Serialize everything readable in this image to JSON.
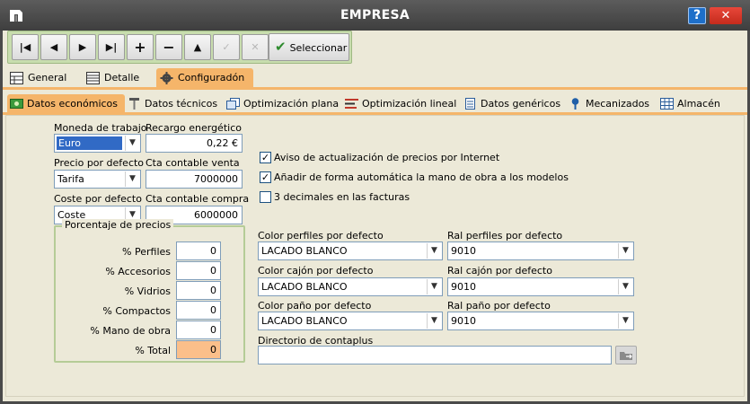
{
  "window": {
    "title": "EMPRESA",
    "help_label": "?",
    "close_label": "✕"
  },
  "toolbar": {
    "first_label": "|◀",
    "prev_label": "◀",
    "next_label": "▶",
    "last_label": "▶|",
    "add_label": "+",
    "remove_label": "−",
    "up_label": "▲",
    "confirm_label": "✓",
    "cancel_label": "✕",
    "select_label": "Seleccionar"
  },
  "main_tabs": [
    {
      "label": "General",
      "icon": "grid-icon"
    },
    {
      "label": "Detalle",
      "icon": "table-icon"
    },
    {
      "label": "Configuradón",
      "icon": "gear-icon",
      "active": true
    }
  ],
  "sub_tabs": [
    {
      "label": "Datos económicos",
      "icon": "money-icon",
      "active": true
    },
    {
      "label": "Datos técnicos",
      "icon": "tools-icon"
    },
    {
      "label": "Optimización plana",
      "icon": "pages-icon"
    },
    {
      "label": "Optimización lineal",
      "icon": "lines-icon"
    },
    {
      "label": "Datos genéricos",
      "icon": "document-icon"
    },
    {
      "label": "Mecanizados",
      "icon": "pin-icon"
    },
    {
      "label": "Almacén",
      "icon": "grid-icon"
    }
  ],
  "economic": {
    "currency_label": "Moneda de trabajo",
    "currency_value": "Euro",
    "energy_label": "Recargo energético",
    "energy_value": "0,22 €",
    "price_label": "Precio por defecto",
    "price_value": "Tarifa",
    "sales_account_label": "Cta contable venta",
    "sales_account_value": "7000000",
    "cost_label": "Coste por defecto",
    "cost_value": "Coste",
    "purchase_account_label": "Cta contable compra",
    "purchase_account_value": "6000000"
  },
  "percentages": {
    "title": "Porcentaje de precios",
    "rows": [
      {
        "label": "% Perfiles",
        "value": "0"
      },
      {
        "label": "% Accesorios",
        "value": "0"
      },
      {
        "label": "% Vidrios",
        "value": "0"
      },
      {
        "label": "% Compactos",
        "value": "0"
      },
      {
        "label": "% Mano de obra",
        "value": "0"
      },
      {
        "label": "% Total",
        "value": "0"
      }
    ]
  },
  "checkboxes": [
    {
      "label": "Aviso de actualización de precios por Internet",
      "checked": true,
      "mark": "✓"
    },
    {
      "label": "Añadir de forma automática la mano de obra a los modelos",
      "checked": true,
      "mark": "✓"
    },
    {
      "label": "3 decimales en las facturas",
      "checked": false,
      "mark": ""
    }
  ],
  "colors": {
    "profiles_color_label": "Color perfiles por defecto",
    "profiles_color_value": "LACADO BLANCO",
    "profiles_ral_label": "Ral perfiles por defecto",
    "profiles_ral_value": "9010",
    "box_color_label": "Color cajón por defecto",
    "box_color_value": "LACADO BLANCO",
    "box_ral_label": "Ral cajón por defecto",
    "box_ral_value": "9010",
    "cloth_color_label": "Color paño por defecto",
    "cloth_color_value": "LACADO BLANCO",
    "cloth_ral_label": "Ral paño por defecto",
    "cloth_ral_value": "9010"
  },
  "directory": {
    "label": "Directorio de contaplus",
    "value": ""
  },
  "theme": {
    "accent": "#f5b56a",
    "toolbar_green": "#c8ddae",
    "total_field": "#fbbf8a"
  }
}
